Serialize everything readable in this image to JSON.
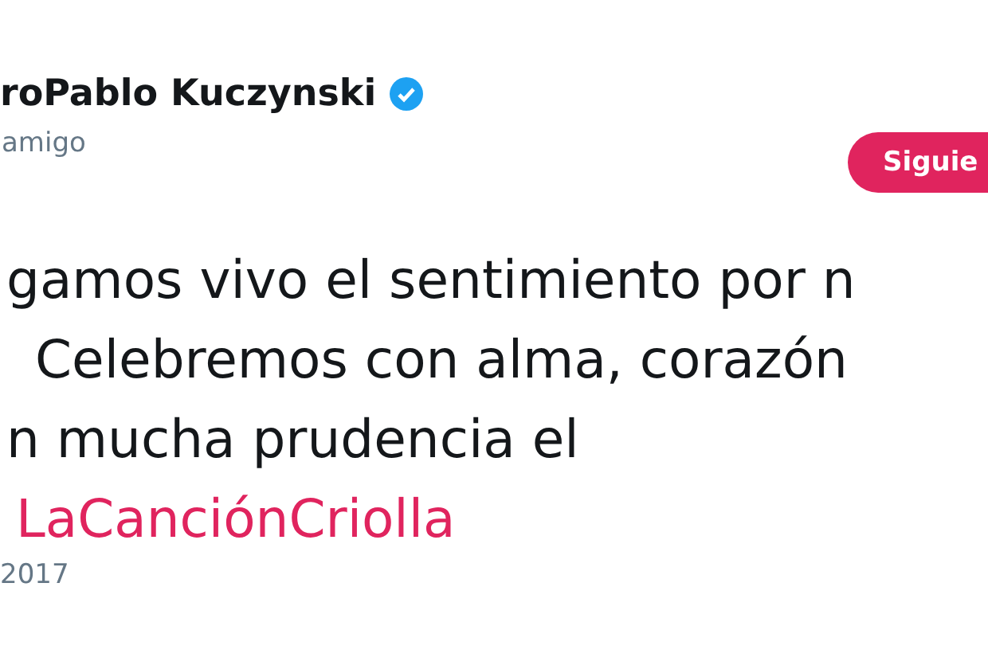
{
  "author": {
    "name": "roPablo Kuczynski",
    "verified": true,
    "handle": "amigo"
  },
  "follow_button": {
    "label": "Siguie"
  },
  "tweet": {
    "lines": [
      {
        "kind": "text",
        "text": "gamos vivo el sentimiento por n"
      },
      {
        "kind": "text",
        "text": "Celebremos con alma, corazón"
      },
      {
        "kind": "text",
        "text": "n mucha prudencia el"
      },
      {
        "kind": "hashtag",
        "text": "LaCanciónCriolla"
      }
    ]
  },
  "date": "2017"
}
